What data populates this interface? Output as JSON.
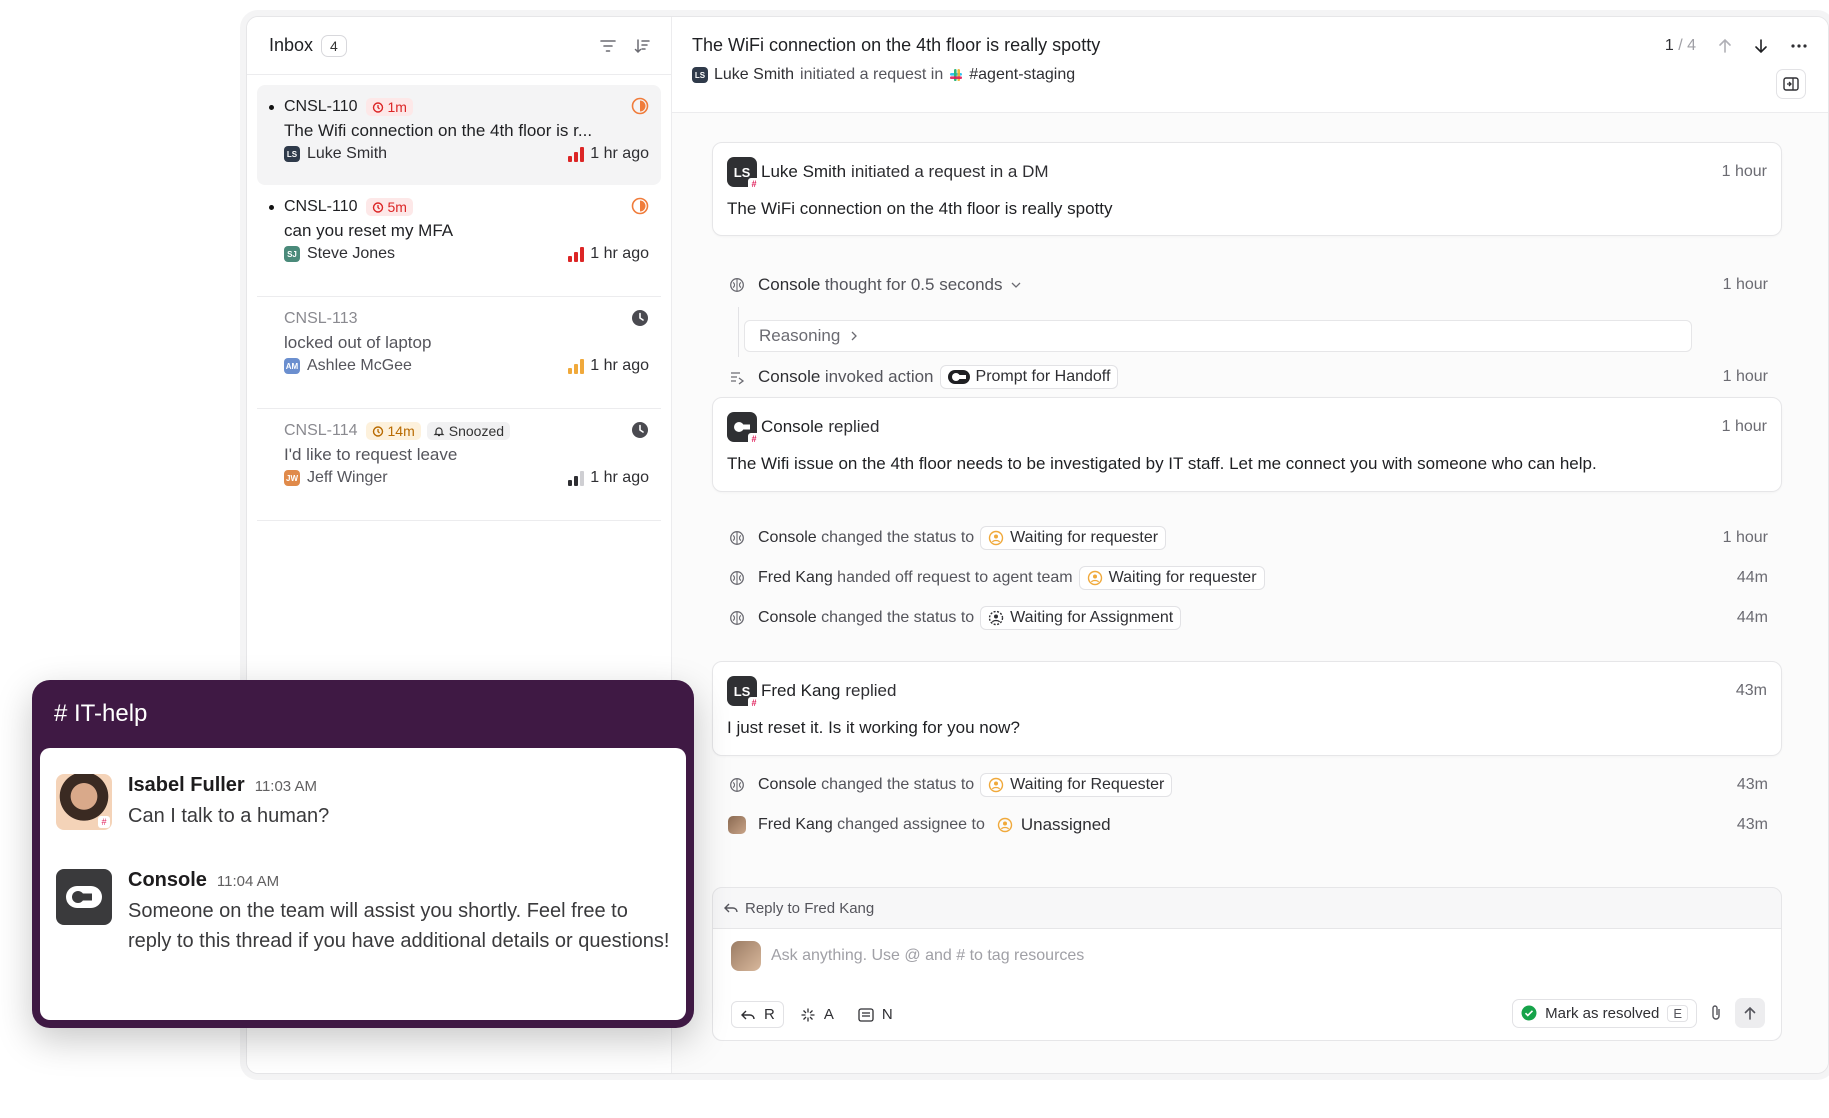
{
  "inbox": {
    "title": "Inbox",
    "count": "4",
    "tickets": [
      {
        "id": "CNSL-110",
        "timer": "1m",
        "subject": "The Wifi connection on the 4th floor is r...",
        "requester": "Luke Smith",
        "initials": "LS",
        "time": "1 hr ago"
      },
      {
        "id": "CNSL-110",
        "timer": "5m",
        "subject": "can you reset my MFA",
        "requester": "Steve Jones",
        "initials": "SJ",
        "time": "1 hr ago"
      },
      {
        "id": "CNSL-113",
        "subject": "locked out of laptop",
        "requester": "Ashlee McGee",
        "initials": "AM",
        "time": "1 hr ago"
      },
      {
        "id": "CNSL-114",
        "timer": "14m",
        "snoozed": "Snoozed",
        "subject": "I'd like to request leave",
        "requester": "Jeff Winger",
        "initials": "JW",
        "time": "1 hr ago"
      }
    ]
  },
  "detail": {
    "title": "The WiFi connection on the 4th floor is really spotty",
    "requester": "Luke Smith",
    "requester_initials": "LS",
    "sub_text": "initiated a request in",
    "channel": "#agent-staging",
    "pager_current": "1",
    "pager_sep": "/",
    "pager_total": "4"
  },
  "timeline": {
    "card1": {
      "initials": "LS",
      "name": "Luke Smith",
      "action": "initiated a request in a DM",
      "time": "1 hour",
      "body": "The WiFi connection on the 4th floor is really spotty"
    },
    "thought": {
      "actor": "Console",
      "text": "thought for 0.5 seconds",
      "time": "1 hour"
    },
    "reasoning": "Reasoning",
    "invoked": {
      "actor": "Console",
      "text": "invoked action",
      "chip": "Prompt for Handoff",
      "time": "1 hour"
    },
    "card2": {
      "name": "Console",
      "action": "replied",
      "time": "1 hour",
      "body": "The Wifi issue on the 4th floor needs to be investigated by IT staff. Let me connect you with someone who can help."
    },
    "ev1": {
      "actor": "Console",
      "text": "changed the status to",
      "chip": "Waiting for requester",
      "time": "1 hour"
    },
    "ev2": {
      "actor": "Fred Kang",
      "text": "handed off request to agent team",
      "chip": "Waiting for requester",
      "time": "44m"
    },
    "ev3": {
      "actor": "Console",
      "text": "changed the status to",
      "chip": "Waiting for Assignment",
      "time": "44m"
    },
    "card3": {
      "initials": "LS",
      "name": "Fred Kang",
      "action": "replied",
      "time": "43m",
      "body": "I just reset it. Is it working for you now?"
    },
    "ev4": {
      "actor": "Console",
      "text": "changed the status to",
      "chip": "Waiting for Requester",
      "time": "43m"
    },
    "ev5": {
      "actor": "Fred Kang",
      "text": "changed assignee to",
      "value": "Unassigned",
      "time": "43m"
    }
  },
  "composer": {
    "reply_to": "Reply to Fred Kang",
    "placeholder": "Ask anything. Use @ and # to tag resources",
    "key_r": "R",
    "key_a": "A",
    "key_n": "N",
    "resolve": "Mark as resolved",
    "resolve_key": "E"
  },
  "slack": {
    "channel": "# IT-help",
    "messages": [
      {
        "sender": "Isabel Fuller",
        "time": "11:03 AM",
        "text": "Can I talk to a human?"
      },
      {
        "sender": "Console",
        "time": "11:04 AM",
        "text": "Someone on the team will assist you shortly. Feel free to reply to this thread if you have additional details or questions!"
      }
    ]
  },
  "colors": {
    "urgent": "#dc2626",
    "medium": "#f0a93b",
    "low": "#2f2f33",
    "slack": "#3f1944",
    "resolved": "#16a34a"
  }
}
